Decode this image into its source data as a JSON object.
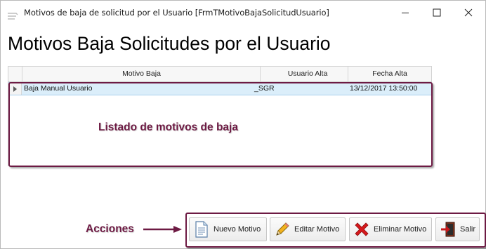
{
  "window": {
    "title": "Motivos de baja de solicitud por el Usuario [FrmTMotivoBajaSolicitudUsuario]",
    "controls": {
      "minimize": "minimize-icon",
      "maximize": "maximize-icon",
      "close": "close-icon"
    }
  },
  "page": {
    "title": "Motivos Baja Solicitudes por el Usuario"
  },
  "grid": {
    "columns": [
      "Motivo Baja",
      "Usuario Alta",
      "Fecha Alta"
    ],
    "rows": [
      {
        "motivo": "Baja Manual Usuario",
        "usuario": "_SGR",
        "fecha": "13/12/2017 13:50:00",
        "selected": true
      }
    ]
  },
  "annotations": {
    "list_label": "Listado de motivos de baja",
    "actions_label": "Acciones",
    "color": "#6d1a43"
  },
  "actions": [
    {
      "label": "Nuevo Motivo",
      "icon": "document-icon"
    },
    {
      "label": "Editar Motivo",
      "icon": "pencil-icon"
    },
    {
      "label": "Eliminar Motivo",
      "icon": "red-x-icon"
    },
    {
      "label": "Salir",
      "icon": "exit-door-icon"
    }
  ],
  "colors": {
    "selected_row": "#dbeefa",
    "header_bg": "#f7f7f7",
    "accent": "#6d1a43"
  }
}
